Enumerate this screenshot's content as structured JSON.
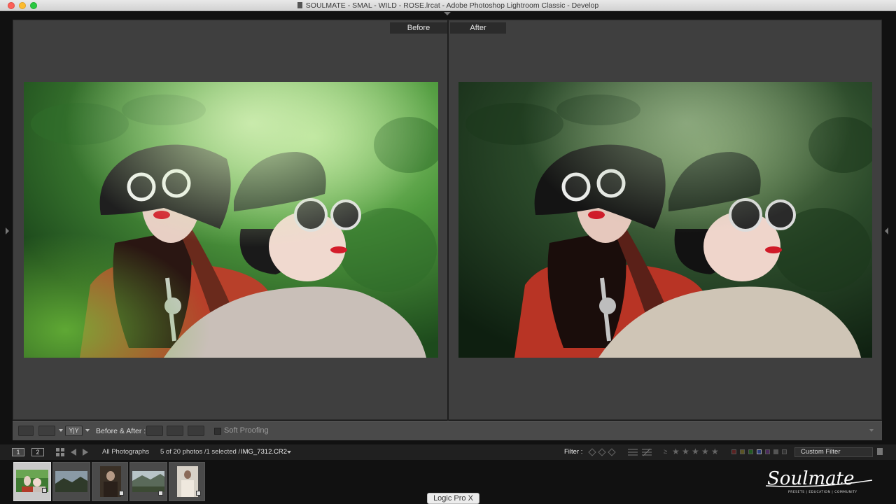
{
  "window": {
    "title": "SOULMATE - SMAL - WILD - ROSE.lrcat - Adobe Photoshop Lightroom Classic - Develop"
  },
  "view": {
    "before_label": "Before",
    "after_label": "After"
  },
  "toolbar": {
    "ry_label": "Y|Y",
    "before_after_label": "Before & After :",
    "soft_proofing_label": "Soft Proofing",
    "soft_proofing_checked": false
  },
  "filmstrip_header": {
    "screen1": "1",
    "screen2": "2",
    "source": "All Photographs",
    "count_text": "5 of 20 photos /1 selected /",
    "filename": "IMG_7312.CR2",
    "filter_label": "Filter :",
    "stars": [
      "★",
      "★",
      "★",
      "★",
      "★"
    ],
    "rating_op": "≥",
    "custom_filter": "Custom Filter"
  },
  "filmstrip": {
    "thumbnails": [
      {
        "scene": "portrait-green",
        "selected": true
      },
      {
        "scene": "landscape-mountains",
        "selected": false
      },
      {
        "scene": "portrait-dark",
        "selected": false
      },
      {
        "scene": "landscape-valley",
        "selected": false
      },
      {
        "scene": "portrait-light",
        "selected": false
      }
    ]
  },
  "branding": {
    "logo": "Soulmate",
    "tagline": "PRESETS | EDUCATION | COMMUNITY"
  },
  "dock": {
    "tooltip": "Logic Pro X"
  },
  "colors": {
    "workspace_bg": "#3f3f3f",
    "panel_bg": "#202020",
    "label_bg": "#2b2b2b"
  }
}
